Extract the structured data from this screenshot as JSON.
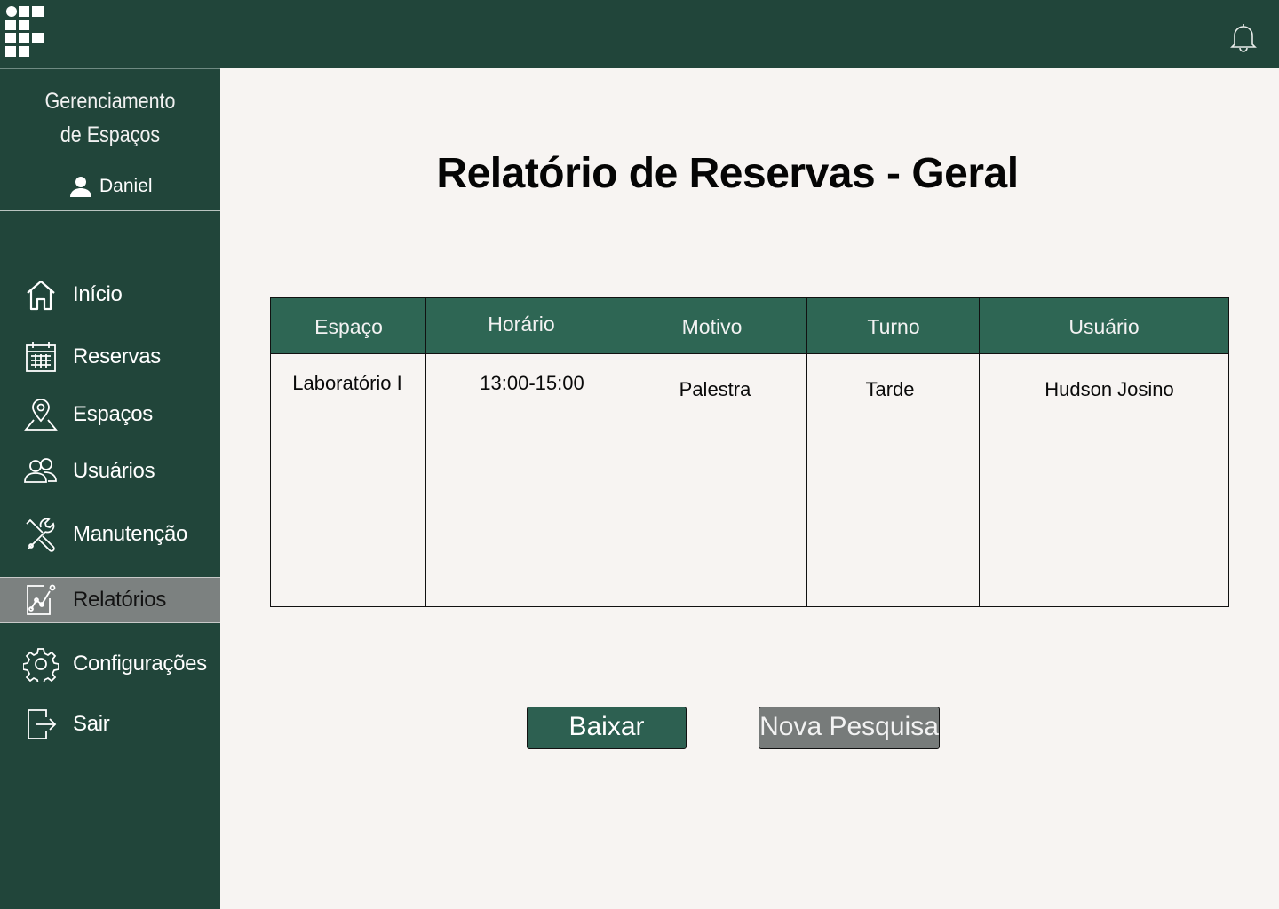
{
  "header": {
    "logo_icon": "institution-logo-icon",
    "notification_icon": "bell-icon"
  },
  "sidebar": {
    "app_title_line1": "Gerenciamento",
    "app_title_line2": "de Espaços",
    "user_name": "Daniel",
    "items": [
      {
        "label": "Início",
        "icon": "home-icon"
      },
      {
        "label": "Reservas",
        "icon": "calendar-icon"
      },
      {
        "label": "Espaços",
        "icon": "map-pin-icon"
      },
      {
        "label": "Usuários",
        "icon": "users-icon"
      },
      {
        "label": "Manutenção",
        "icon": "tools-icon"
      },
      {
        "label": "Relatórios",
        "icon": "report-chart-icon",
        "active": true
      },
      {
        "label": "Configurações",
        "icon": "gear-icon"
      },
      {
        "label": "Sair",
        "icon": "logout-icon"
      }
    ]
  },
  "main": {
    "title": "Relatório de Reservas - Geral",
    "table": {
      "columns": [
        "Espaço",
        "Horário",
        "Motivo",
        "Turno",
        "Usuário"
      ],
      "rows": [
        [
          "Laboratório I",
          "13:00-15:00",
          "Palestra",
          "Tarde",
          "Hudson Josino"
        ]
      ]
    },
    "buttons": {
      "download_label": "Baixar",
      "new_search_label": "Nova Pesquisa"
    }
  },
  "colors": {
    "header_bg": "#21453a",
    "table_header_bg": "#2e6654",
    "active_item_bg": "#7c8180",
    "page_bg": "#f7f4f2"
  }
}
